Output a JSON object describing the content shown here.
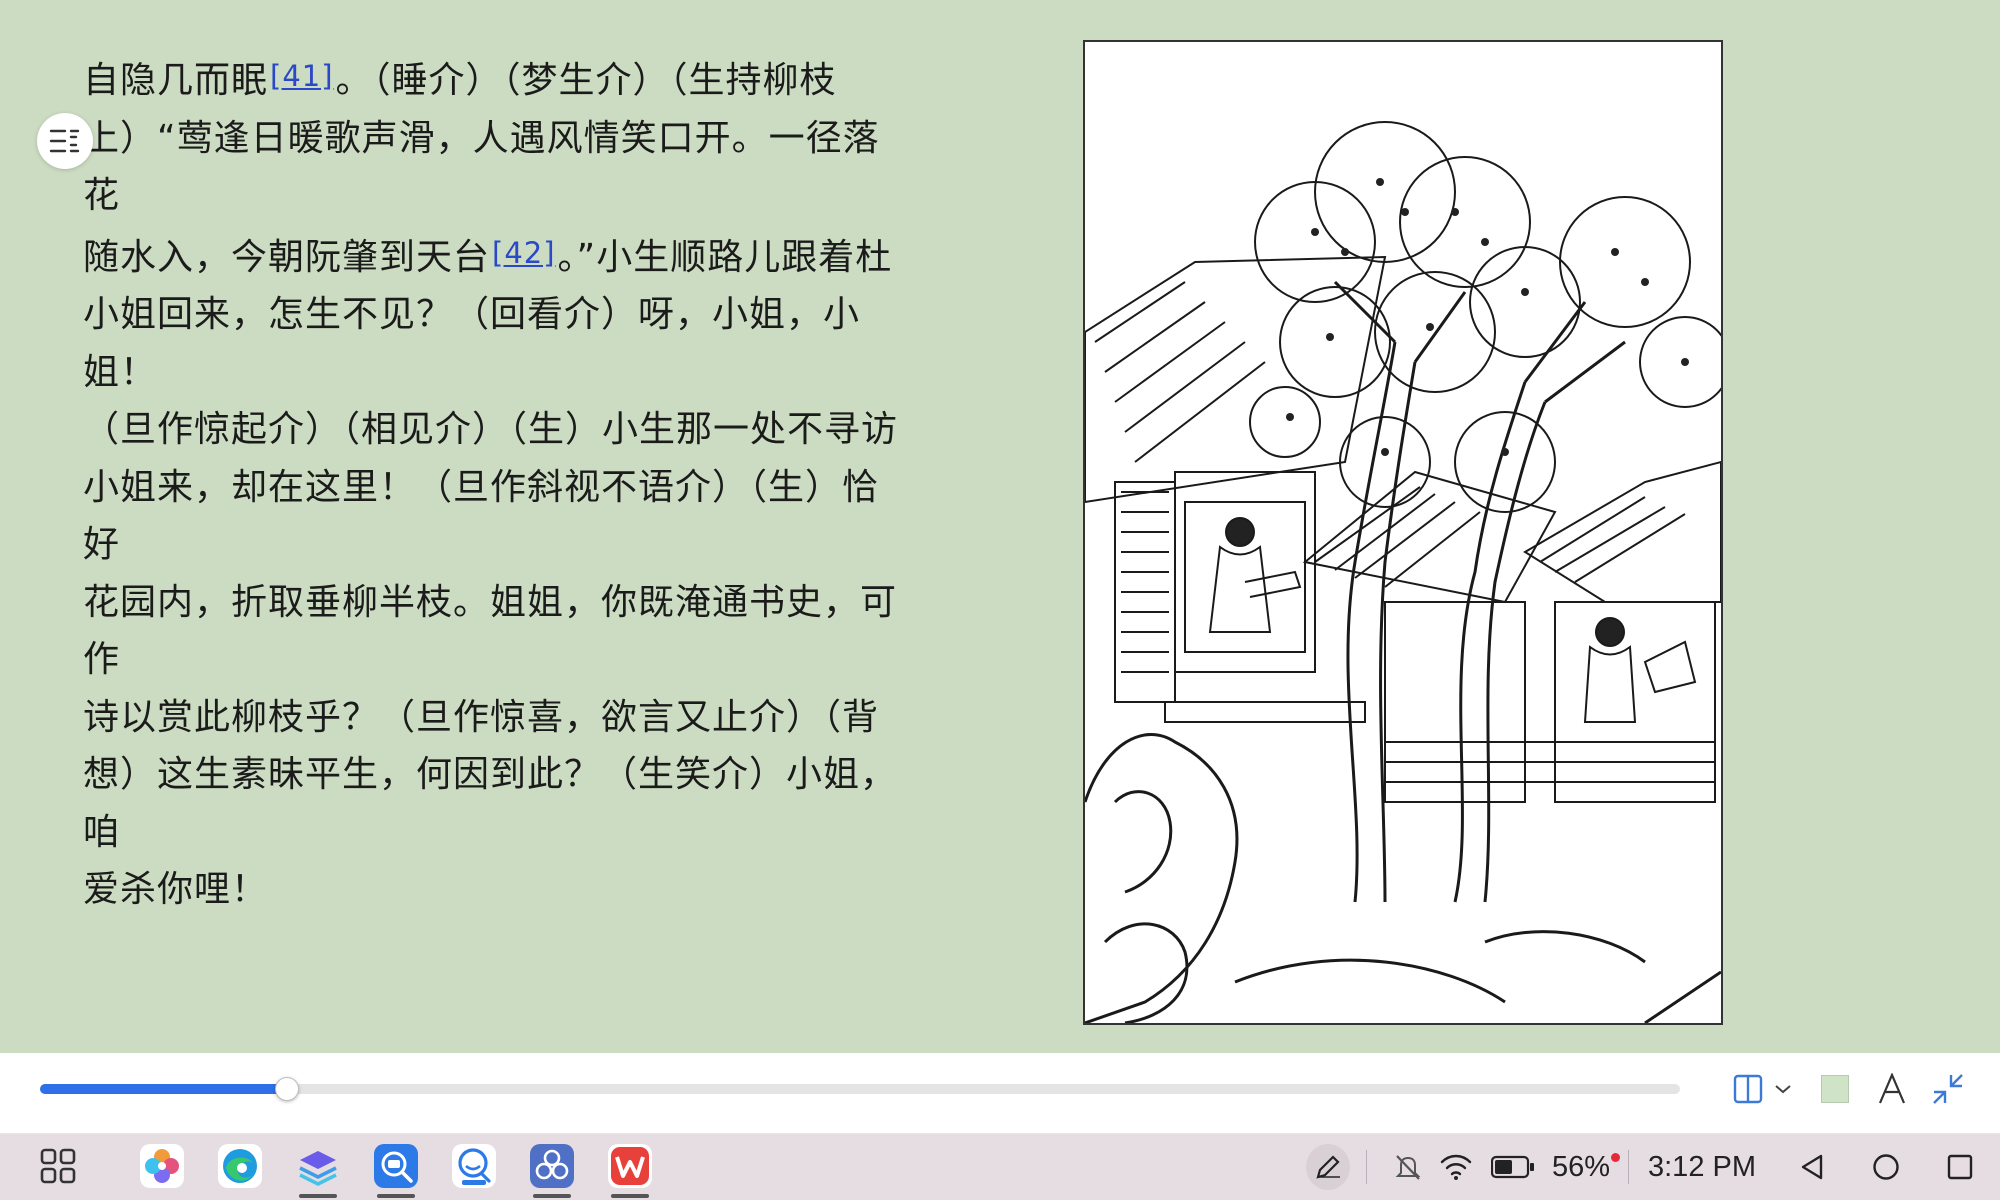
{
  "reader": {
    "lines": [
      [
        "自隐几而眠",
        "[41]",
        "。（睡介）（梦生介）（生持柳枝"
      ],
      [
        "上）“莺逢日暖歌声滑，人遇风情笑口开。一径落花"
      ],
      [
        "随水入，今朝阮肇到天台",
        "[42]",
        "。”小生顺路儿跟着杜"
      ],
      [
        "小姐回来，怎生不见？（回看介）呀，小姐，小姐！"
      ],
      [
        "（旦作惊起介）（相见介）（生）小生那一处不寻访"
      ],
      [
        "小姐来，却在这里！（旦作斜视不语介）（生）恰好"
      ],
      [
        "花园内，折取垂柳半枝。姐姐，你既淹通书史，可作"
      ],
      [
        "诗以赏此柳枝乎？（旦作惊喜，欲言又止介）（背"
      ],
      [
        "想）这生素昧平生，何因到此？（生笑介）小姐，咱"
      ],
      [
        "爱杀你哩！"
      ]
    ],
    "toc_icon": "list-icon",
    "illustration": "woodblock-print-garden-scene"
  },
  "toolbar": {
    "progress": 0.15,
    "icons": [
      "columns-icon",
      "chevron-down-icon",
      "background-color-swatch",
      "font-icon",
      "collapse-icon"
    ],
    "swatch_color": "#cfe3c7",
    "accent": "#2f6fe8"
  },
  "taskbar": {
    "apps": [
      "app-grid-icon",
      "gallery-app-icon",
      "edge-browser-icon",
      "layers-app-icon",
      "dictionary-app-icon",
      "chat-app-icon",
      "petal-app-icon",
      "wps-office-icon"
    ],
    "battery_percent": "56%",
    "clock": "3:12 PM",
    "nav": [
      "back-icon",
      "home-icon",
      "recents-icon"
    ]
  }
}
